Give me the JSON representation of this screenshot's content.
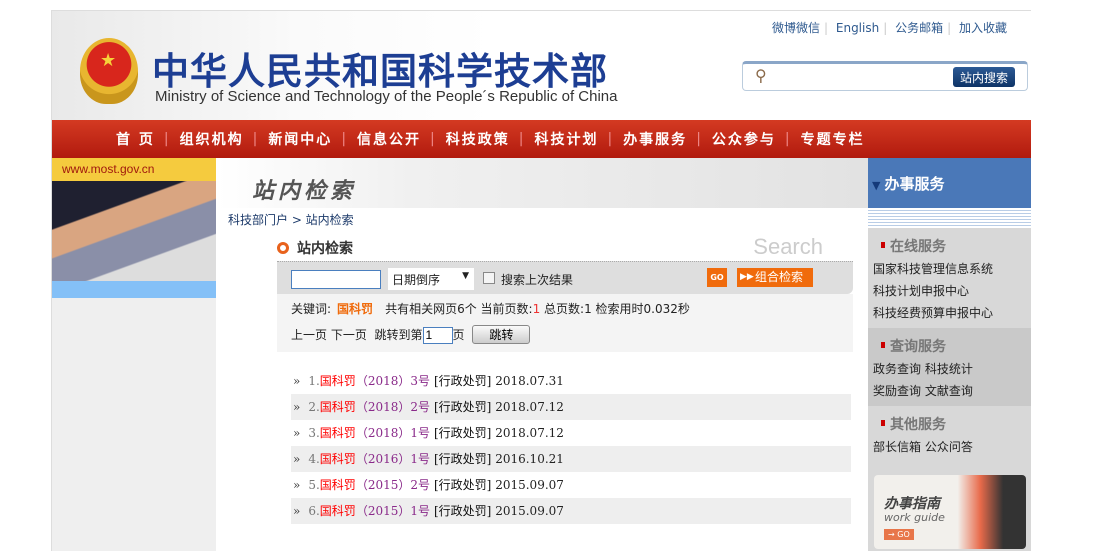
{
  "header": {
    "title_cn": "中华人民共和国科学技术部",
    "title_en": "Ministry of Science and Technology of the People´s Republic of China",
    "top_links": [
      "微博微信",
      "English",
      "公务邮箱",
      "加入收藏"
    ],
    "search_button": "站内搜索",
    "search_placeholder": ""
  },
  "nav": [
    "首 页",
    "组织机构",
    "新闻中心",
    "信息公开",
    "科技政策",
    "科技计划",
    "办事服务",
    "公众参与",
    "专题专栏"
  ],
  "left": {
    "url": "www.most.gov.cn"
  },
  "center": {
    "banner": "站内检索",
    "breadcrumb": "科技部门户 > 站内检索",
    "section_title": "站内检索",
    "search_word": "Search",
    "sort_select": "日期倒序",
    "checkbox_label": "搜索上次结果",
    "go_label": "GO",
    "combo_label": "组合检索",
    "keyword_label": "关键词:",
    "keyword": "国科罚",
    "summary_pre": "共有相关网页6个  当前页数:",
    "current_page": "1",
    "total_label": "  总页数:",
    "total_pages": "1",
    "time_label": " 检索用时0.032秒",
    "prev": "上一页",
    "next": "下一页",
    "jump_label": "跳转到第",
    "page_input": "1",
    "page_suffix": "页",
    "jump_button": "跳转",
    "results": [
      {
        "n": "1.",
        "kw": "国科罚",
        "num": "（2018）3号",
        "tag": "[行政处罚]",
        "date": "2018.07.31"
      },
      {
        "n": "2.",
        "kw": "国科罚",
        "num": "（2018）2号",
        "tag": "[行政处罚]",
        "date": "2018.07.12"
      },
      {
        "n": "3.",
        "kw": "国科罚",
        "num": "（2018）1号",
        "tag": "[行政处罚]",
        "date": "2018.07.12"
      },
      {
        "n": "4.",
        "kw": "国科罚",
        "num": "（2016）1号",
        "tag": "[行政处罚]",
        "date": "2016.10.21"
      },
      {
        "n": "5.",
        "kw": "国科罚",
        "num": "（2015）2号",
        "tag": "[行政处罚]",
        "date": "2015.09.07"
      },
      {
        "n": "6.",
        "kw": "国科罚",
        "num": "（2015）1号",
        "tag": "[行政处罚]",
        "date": "2015.09.07"
      }
    ]
  },
  "right": {
    "title": "办事服务",
    "groups": [
      {
        "title": "在线服务",
        "items": [
          "国家科技管理信息系统",
          "科技计划申报中心",
          "科技经费预算申报中心"
        ]
      },
      {
        "title": "查询服务",
        "items": [
          "政务查询 科技统计",
          "奖励查询 文献查询"
        ]
      },
      {
        "title": "其他服务",
        "items": [
          "部长信箱 公众问答"
        ]
      }
    ],
    "guide": {
      "title": "办事指南",
      "subtitle": "work guide",
      "go": "→ GO"
    }
  }
}
